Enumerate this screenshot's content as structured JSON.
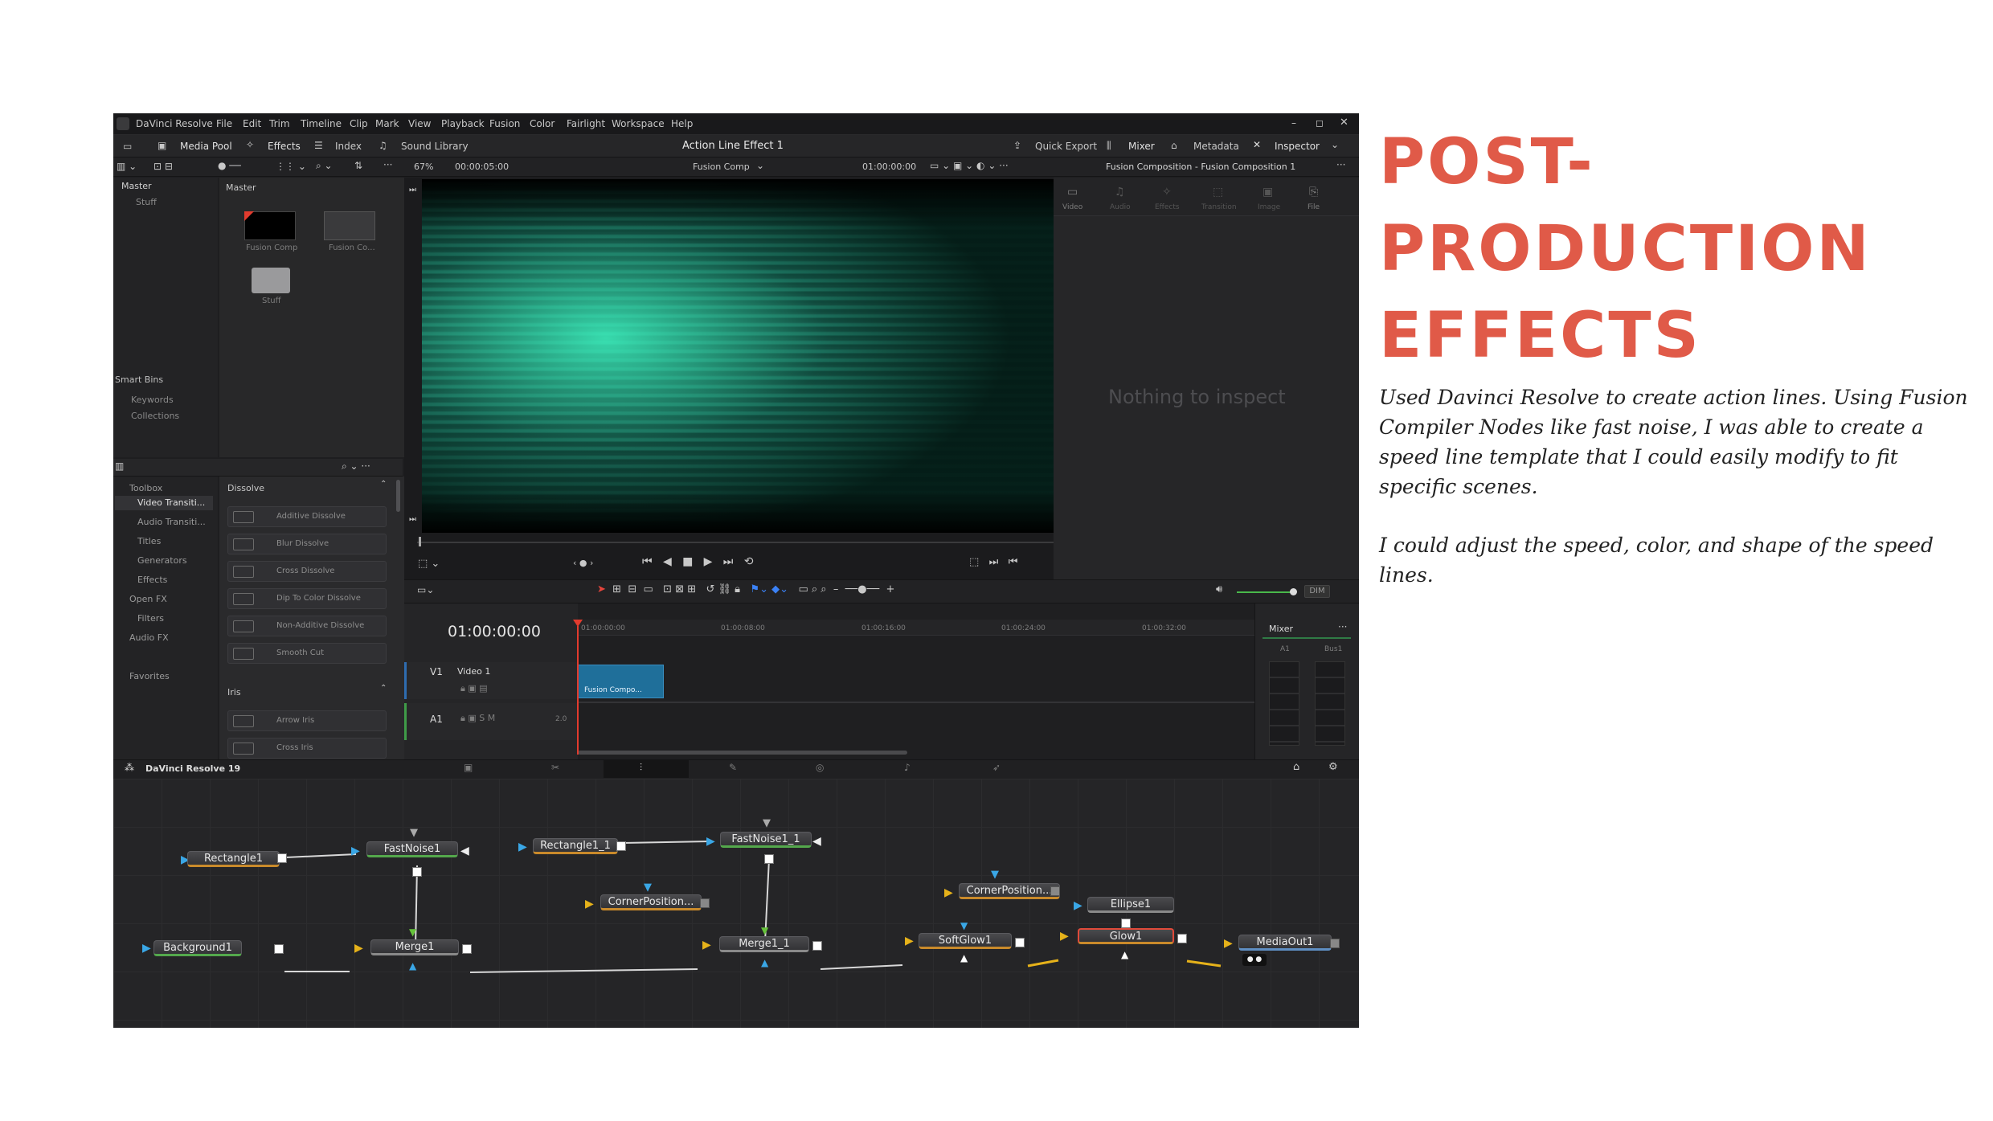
{
  "app": {
    "name": "DaVinci Resolve",
    "menu": [
      "File",
      "Edit",
      "Trim",
      "Timeline",
      "Clip",
      "Mark",
      "View",
      "Playback",
      "Fusion",
      "Color",
      "Fairlight",
      "Workspace",
      "Help"
    ],
    "project_title": "Action Line Effect 1",
    "brand_footer": "DaVinci Resolve 19"
  },
  "toolbar": {
    "media_pool": "Media Pool",
    "effects": "Effects",
    "index": "Index",
    "sound_library": "Sound Library",
    "quick_export": "Quick Export",
    "mixer": "Mixer",
    "metadata": "Metadata",
    "inspector": "Inspector"
  },
  "viewer": {
    "zoom": "67%",
    "timecode_left": "00:00:05:00",
    "comp_name": "Fusion Comp",
    "timecode_right": "01:00:00:00"
  },
  "inspector": {
    "title": "Fusion Composition - Fusion Composition 1",
    "tabs": [
      "Video",
      "Audio",
      "Effects",
      "Transition",
      "Image",
      "File"
    ],
    "empty_message": "Nothing to inspect"
  },
  "media_pool": {
    "tree": [
      "Master",
      "Stuff"
    ],
    "header": "Master",
    "clips": [
      "Fusion Comp",
      "Fusion Co...",
      "Stuff"
    ],
    "smart_bins_title": "Smart Bins",
    "smart_bins": [
      "Keywords",
      "Collections"
    ]
  },
  "effects_library": {
    "tree": [
      "Toolbox",
      "Video Transiti...",
      "Audio Transiti...",
      "Titles",
      "Generators",
      "Effects",
      "Open FX",
      "Filters",
      "Audio FX",
      "Favorites"
    ],
    "group_dissolve": "Dissolve",
    "dissolve_items": [
      "Additive Dissolve",
      "Blur Dissolve",
      "Cross Dissolve",
      "Dip To Color Dissolve",
      "Non-Additive Dissolve",
      "Smooth Cut"
    ],
    "group_iris": "Iris",
    "iris_items": [
      "Arrow Iris",
      "Cross Iris"
    ]
  },
  "timeline": {
    "timecode": "01:00:00:00",
    "ruler": [
      "01:00:00:00",
      "01:00:08:00",
      "01:00:16:00",
      "01:00:24:00",
      "01:00:32:00"
    ],
    "v1": "V1",
    "video_track": "Video 1",
    "a1": "A1",
    "audio_level": "2.0",
    "clip": "Fusion Compo...",
    "dim_label": "DIM"
  },
  "mixer": {
    "title": "Mixer",
    "channels": [
      "A1",
      "Bus1"
    ]
  },
  "nodes": {
    "rectangle1": "Rectangle1",
    "fastnoise1": "FastNoise1",
    "rectangle1_1": "Rectangle1_1",
    "fastnoise1_1": "FastNoise1_1",
    "cornerposition_a": "CornerPosition...",
    "cornerposition_b": "CornerPosition...",
    "ellipse1": "Ellipse1",
    "background1": "Background1",
    "merge1": "Merge1",
    "merge1_1": "Merge1_1",
    "softglow1": "SoftGlow1",
    "glow1": "Glow1",
    "mediaout1": "MediaOut1"
  },
  "slide": {
    "heading": "POST-\nPRODUCTION\nEFFECTS",
    "paragraph1": "Used Davinci Resolve to create action lines. Using Fusion Compiler Nodes like fast noise, I was able to create a speed line template that I could easily modify to fit specific scenes.",
    "paragraph2": "I could adjust the speed, color, and shape of the speed lines."
  },
  "colors": {
    "heading": "#e05a48",
    "viewer_accent": "#20d8a8",
    "clip": "#1f6f9a"
  }
}
